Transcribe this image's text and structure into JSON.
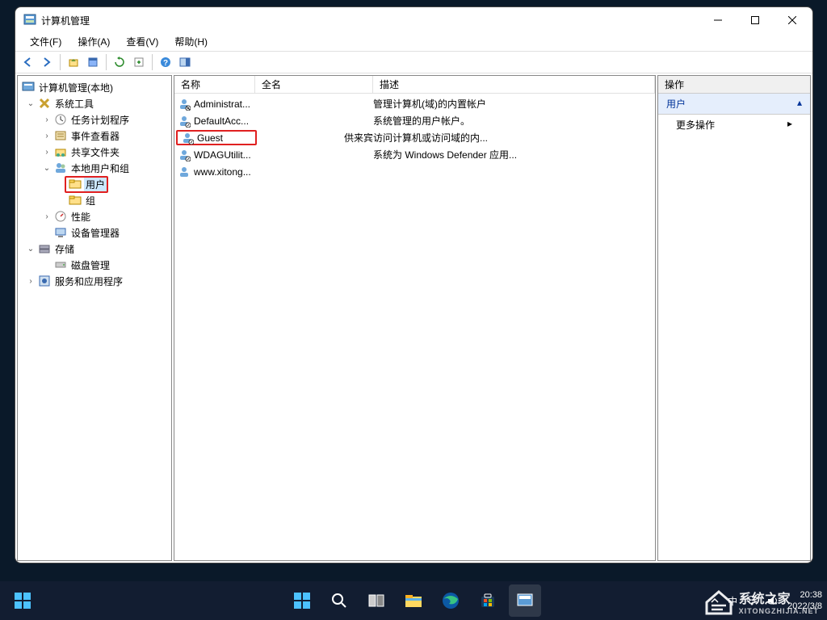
{
  "window": {
    "title": "计算机管理"
  },
  "menu": {
    "file": "文件(F)",
    "action": "操作(A)",
    "view": "查看(V)",
    "help": "帮助(H)"
  },
  "tree": {
    "root": "计算机管理(本地)",
    "systools": "系统工具",
    "scheduler": "任务计划程序",
    "eventviewer": "事件查看器",
    "shared": "共享文件夹",
    "localusers": "本地用户和组",
    "users": "用户",
    "groups": "组",
    "perf": "性能",
    "devmgr": "设备管理器",
    "storage": "存储",
    "diskmgmt": "磁盘管理",
    "services": "服务和应用程序"
  },
  "list": {
    "cols": {
      "name": "名称",
      "fullname": "全名",
      "desc": "描述"
    },
    "rows": [
      {
        "name": "Administrat...",
        "full": "",
        "desc": "管理计算机(域)的内置帐户"
      },
      {
        "name": "DefaultAcc...",
        "full": "",
        "desc": "系统管理的用户帐户。"
      },
      {
        "name": "Guest",
        "full": "",
        "desc": "供来宾访问计算机或访问域的内..."
      },
      {
        "name": "WDAGUtilit...",
        "full": "",
        "desc": "系统为 Windows Defender 应用..."
      },
      {
        "name": "www.xitong...",
        "full": "",
        "desc": ""
      }
    ]
  },
  "actions": {
    "header": "操作",
    "section": "用户",
    "more": "更多操作"
  },
  "systray": {
    "time": "20:38",
    "date": "2022/3/8"
  },
  "watermark": {
    "brand": "系统之家",
    "sub": "XITONGZHIJIA.NET"
  }
}
